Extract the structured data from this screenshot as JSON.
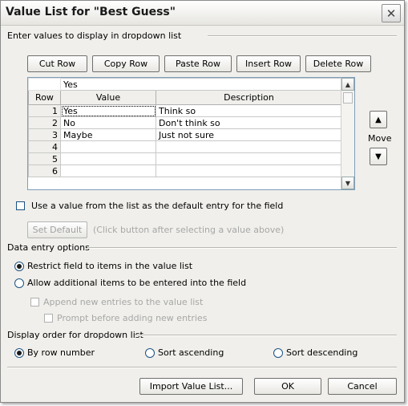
{
  "window": {
    "title": "Value List for \"Best Guess\"",
    "close_glyph": "✕"
  },
  "values_group": {
    "label": "Enter values to display in dropdown list",
    "buttons": {
      "cut_row": "Cut Row",
      "copy_row": "Copy Row",
      "paste_row": "Paste Row",
      "insert_row": "Insert Row",
      "delete_row": "Delete Row"
    },
    "grid": {
      "edit_value": "Yes",
      "columns": [
        "Row",
        "Value",
        "Description"
      ],
      "rows": [
        {
          "row": "1",
          "value": "Yes",
          "description": "Think so"
        },
        {
          "row": "2",
          "value": "No",
          "description": "Don't think so"
        },
        {
          "row": "3",
          "value": "Maybe",
          "description": "Just not sure"
        },
        {
          "row": "4",
          "value": "",
          "description": ""
        },
        {
          "row": "5",
          "value": "",
          "description": ""
        },
        {
          "row": "6",
          "value": "",
          "description": ""
        }
      ]
    },
    "move_label": "Move",
    "default_checkbox_label": "Use a value from the list as the default entry for the field",
    "set_default_button": "Set Default",
    "set_default_hint": "(Click button after selecting a value above)"
  },
  "data_entry": {
    "label": "Data entry options",
    "restrict_label": "Restrict field to items in the value list",
    "allow_label": "Allow additional items to be entered into the field",
    "append_label": "Append new entries to the value list",
    "prompt_label": "Prompt before adding new entries",
    "selected": "restrict"
  },
  "display_order": {
    "label": "Display order for dropdown list",
    "by_row_label": "By row number",
    "sort_asc_label": "Sort ascending",
    "sort_desc_label": "Sort descending",
    "selected": "by_row"
  },
  "footer": {
    "import_button": "Import Value List...",
    "ok_button": "OK",
    "cancel_button": "Cancel"
  }
}
